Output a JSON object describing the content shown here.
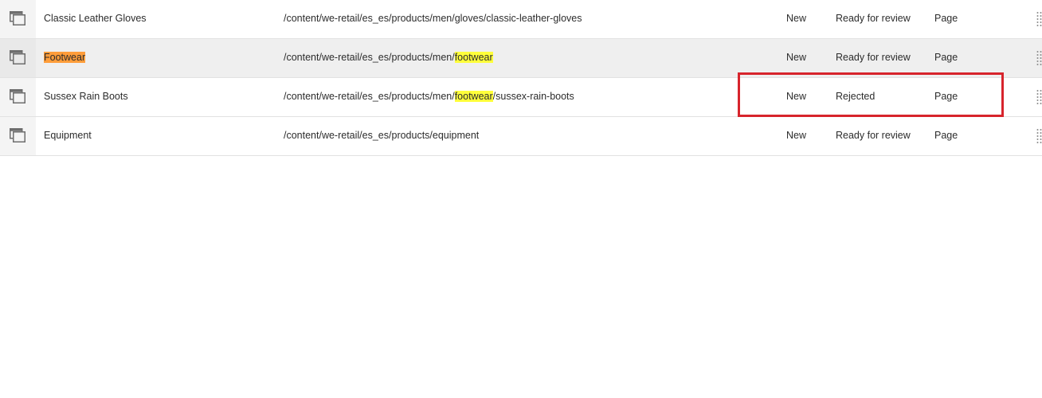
{
  "rows": [
    {
      "thumbnail_icon": "page-icon",
      "title": "Classic Leather Gloves",
      "path_pre": "/content/we-retail/es_es/products/men/gloves/classic-leather-gloves",
      "path_match": "",
      "path_post": "",
      "translation": "New",
      "status": "Ready for review",
      "type": "Page"
    },
    {
      "thumbnail_icon": "page-icon",
      "title": "Footwear",
      "path_pre": "/content/we-retail/es_es/products/men/",
      "path_match": "footwear",
      "path_post": "",
      "translation": "New",
      "status": "Ready for review",
      "type": "Page"
    },
    {
      "thumbnail_icon": "page-icon",
      "title": "Sussex Rain Boots",
      "path_pre": "/content/we-retail/es_es/products/men/",
      "path_match": "footwear",
      "path_post": "/sussex-rain-boots",
      "translation": "New",
      "status": "Rejected",
      "type": "Page"
    },
    {
      "thumbnail_icon": "page-icon",
      "title": "Equipment",
      "path_pre": "/content/we-retail/es_es/products/equipment",
      "path_match": "",
      "path_post": "",
      "translation": "New",
      "status": "Ready for review",
      "type": "Page"
    }
  ],
  "colors": {
    "search_highlight": "#ffff3b",
    "title_highlight": "#ff9d3a",
    "annotation_box": "#d7242c",
    "selected_row": "#efefef"
  }
}
